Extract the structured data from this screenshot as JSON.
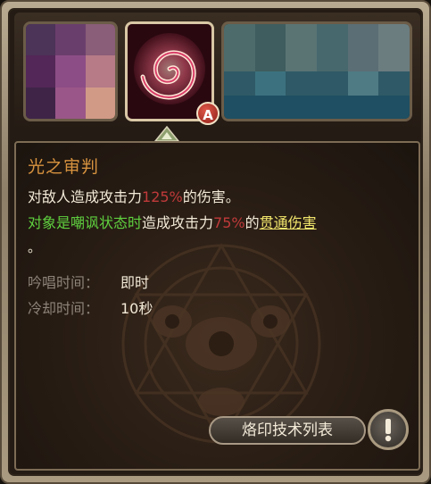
{
  "skill_badge": "A",
  "tooltip": {
    "title": "光之审判",
    "line1": {
      "pre": "对敌人造成攻击力",
      "value": "125%",
      "post": "的伤害。"
    },
    "line2": {
      "cond": "对象是嘲讽状态时",
      "mid": "造成攻击力",
      "value": "75%",
      "post": "的",
      "keyword": "贯通伤害"
    },
    "line3": "。",
    "cast_label": "吟唱时间：",
    "cast_value": "即时",
    "cooldown_label": "冷却时间：",
    "cooldown_value": "10秒"
  },
  "footer": {
    "list_button": "烙印技术列表",
    "info_icon": "exclamation-icon"
  },
  "colors": {
    "title": "#d8933f",
    "damage": "#c03a3a",
    "condition": "#5fd13f",
    "keyword": "#f1e56c"
  }
}
